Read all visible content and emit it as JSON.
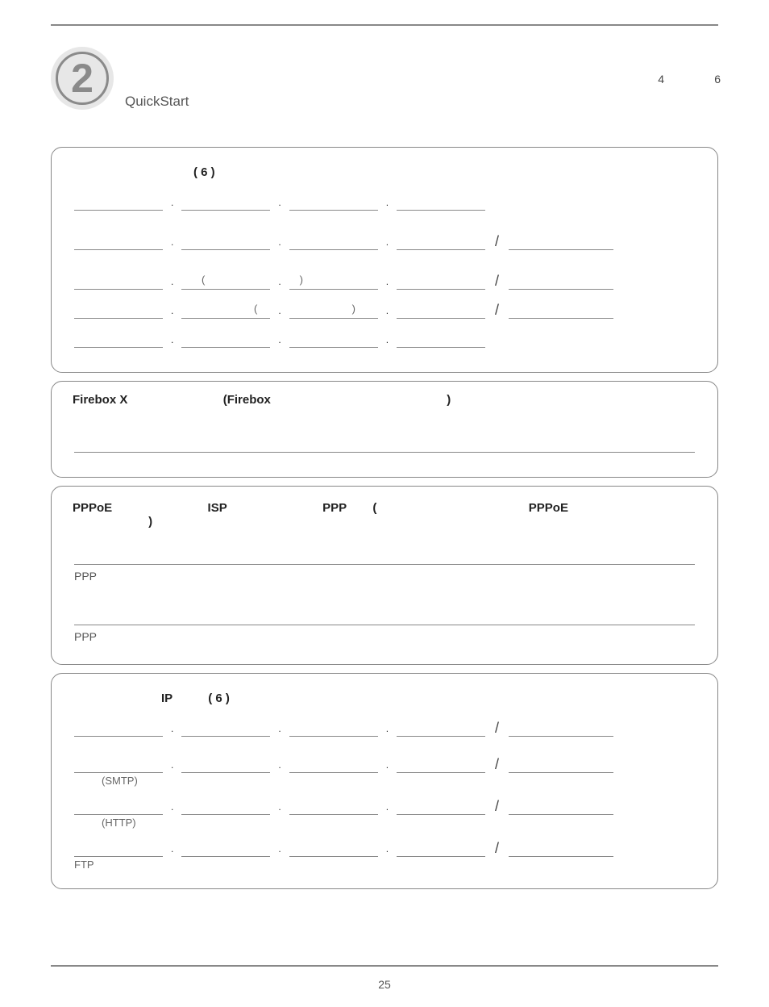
{
  "header": {
    "step_number": "2",
    "quickstart_label": "QuickStart",
    "right_a": "4",
    "right_b": "6"
  },
  "box1": {
    "title": "(   6      )",
    "note1_open": "(",
    "note1_close": ")",
    "note2_open": "(",
    "note2_close": ")"
  },
  "box2": {
    "firebox_x": "Firebox X",
    "firebox_paren": "(Firebox",
    "paren_close": ")"
  },
  "box3": {
    "pppoe": "PPPoE",
    "isp": "ISP",
    "ppp": "PPP",
    "paren_open": "(",
    "paren_close": ")",
    "pppoe_right": "PPPoE",
    "ppp_label": "PPP"
  },
  "box4": {
    "title_ip": "IP",
    "title_paren": "(   6      )",
    "smtp": "(SMTP)",
    "http": "(HTTP)",
    "ftp": "FTP"
  },
  "page_number": "25"
}
